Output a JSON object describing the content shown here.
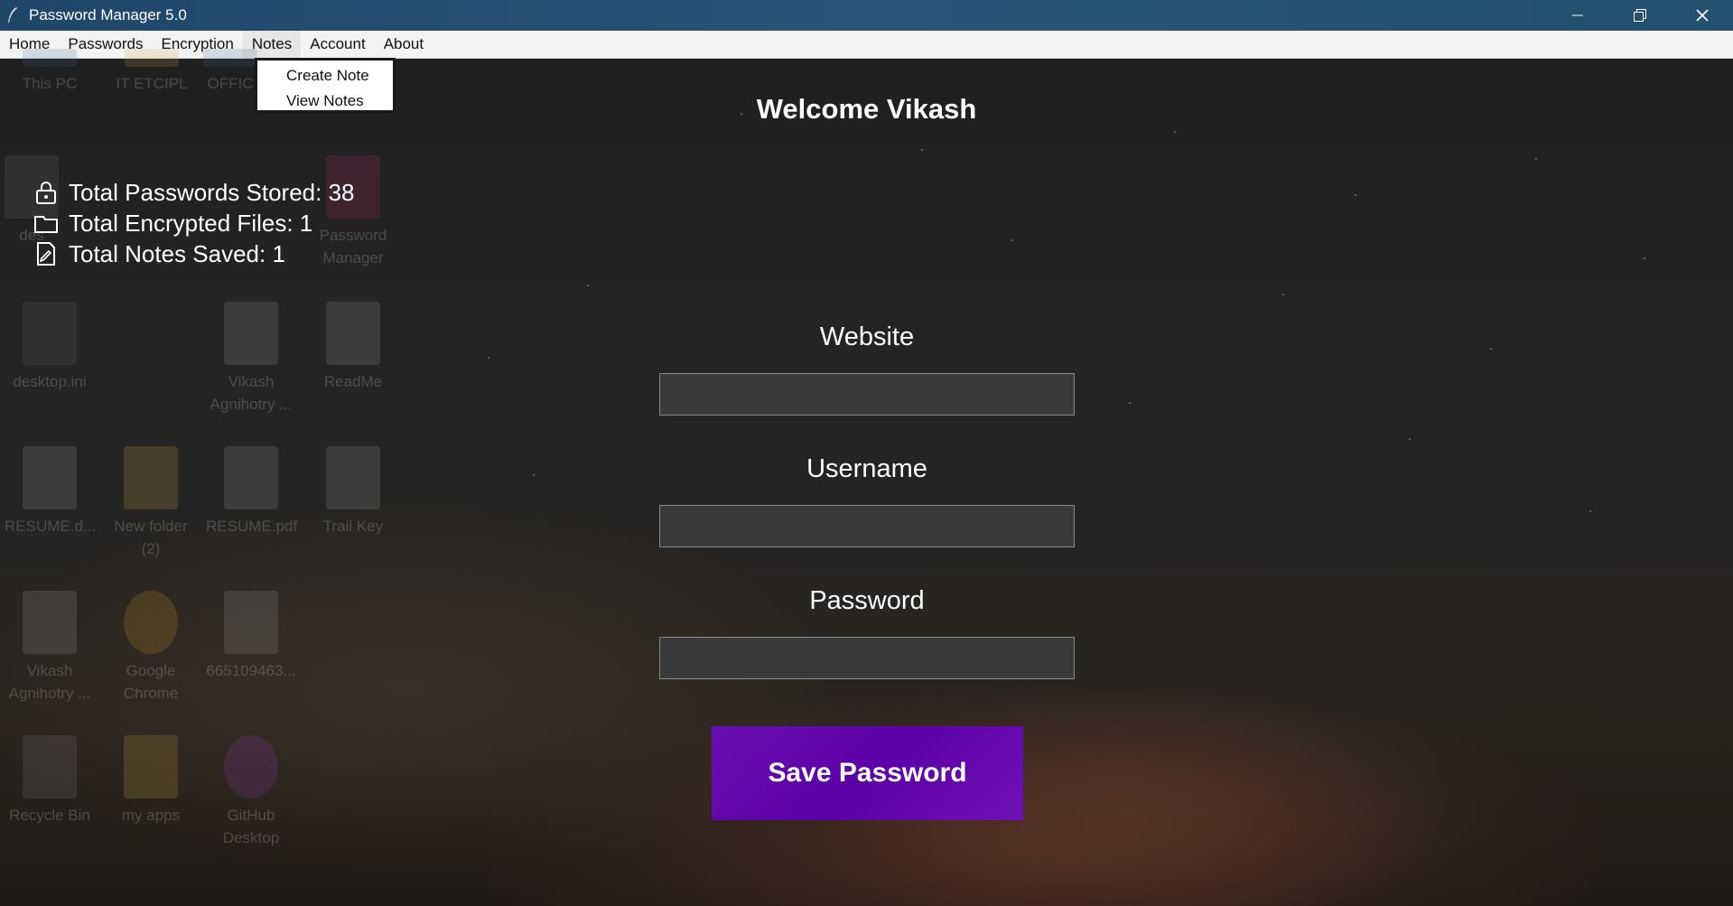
{
  "window": {
    "title": "Password Manager 5.0"
  },
  "menubar": {
    "items": [
      "Home",
      "Passwords",
      "Encryption",
      "Notes",
      "Account",
      "About"
    ]
  },
  "notes_menu": {
    "items": [
      "Create Note",
      "View Notes"
    ]
  },
  "desktop_icons": [
    {
      "label": "This PC"
    },
    {
      "label": "IT ETCIPL"
    },
    {
      "label": "OFFIC"
    },
    {
      "label": "des"
    },
    {
      "label": "Password Manager"
    },
    {
      "label": "desktop.ini"
    },
    {
      "label": "Vikash Agnihotry ..."
    },
    {
      "label": "ReadMe"
    },
    {
      "label": "RESUME.d..."
    },
    {
      "label": "New folder (2)"
    },
    {
      "label": "RESUME.pdf"
    },
    {
      "label": "Trail Key"
    },
    {
      "label": "Vikash Agnihotry ..."
    },
    {
      "label": "Google Chrome"
    },
    {
      "label": "665109463..."
    },
    {
      "label": "Recycle Bin"
    },
    {
      "label": "my apps"
    },
    {
      "label": "GitHub Desktop"
    }
  ],
  "stats": {
    "passwords": "Total Passwords Stored: 38",
    "files": "Total Encrypted Files: 1",
    "notes": "Total Notes Saved: 1"
  },
  "main": {
    "welcome": "Welcome Vikash",
    "website_label": "Website",
    "website_value": "",
    "username_label": "Username",
    "username_value": "",
    "password_label": "Password",
    "password_value": "",
    "save_label": "Save Password"
  },
  "colors": {
    "titlebar": "#24506f",
    "button": "#5c00a8"
  }
}
